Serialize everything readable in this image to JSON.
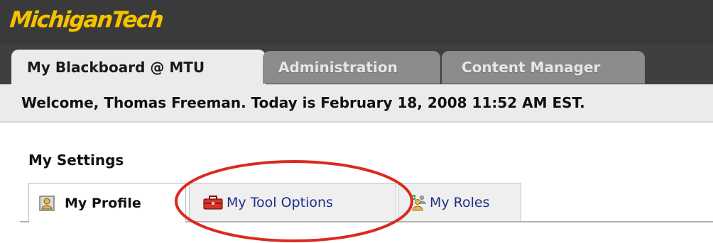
{
  "brand": {
    "logo_text": "MichiganTech"
  },
  "nav": {
    "tabs": [
      {
        "label": "My Blackboard @ MTU",
        "active": true
      },
      {
        "label": "Administration",
        "active": false
      },
      {
        "label": "Content Manager",
        "active": false
      }
    ]
  },
  "welcome": {
    "text": "Welcome, Thomas Freeman. Today is February 18, 2008 11:52 AM EST."
  },
  "settings": {
    "title": "My Settings",
    "tabs": [
      {
        "label": "My Profile",
        "icon": "profile-icon",
        "active": true
      },
      {
        "label": "My Tool Options",
        "icon": "toolbox-icon",
        "active": false,
        "highlighted": true
      },
      {
        "label": "My Roles",
        "icon": "roles-icon",
        "active": false
      }
    ]
  },
  "colors": {
    "header_bg": "#3f3f3f",
    "logo": "#f5c200",
    "inactive_tab": "#8b8b8b",
    "link": "#1f2f87",
    "highlight": "#d92b1e"
  }
}
